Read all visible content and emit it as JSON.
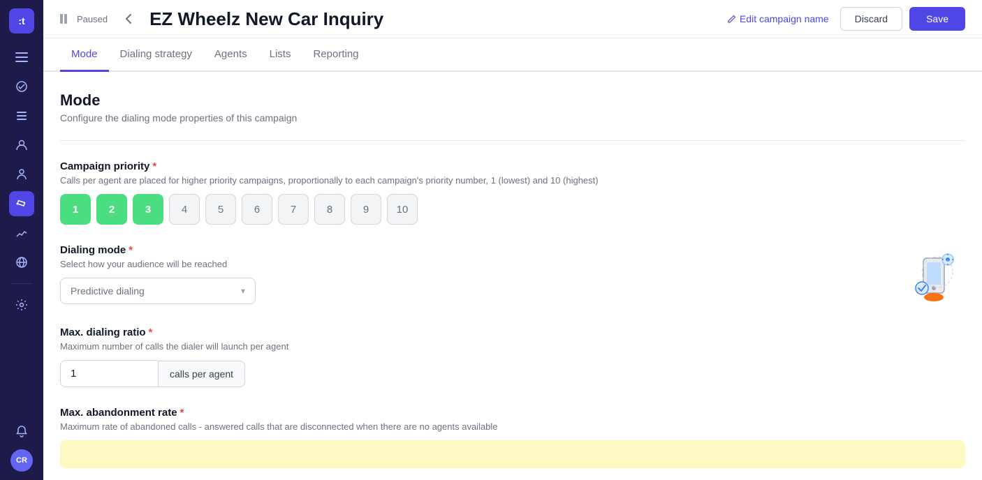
{
  "sidebar": {
    "logo": ":t",
    "items": [
      {
        "name": "menu",
        "icon": "☰",
        "active": false
      },
      {
        "name": "activity",
        "icon": "◎",
        "active": false
      },
      {
        "name": "list",
        "icon": "≡",
        "active": false
      },
      {
        "name": "users",
        "icon": "👤",
        "active": false
      },
      {
        "name": "person",
        "icon": "🧑",
        "active": false
      },
      {
        "name": "campaigns",
        "icon": "📣",
        "active": true
      },
      {
        "name": "analytics",
        "icon": "📊",
        "active": false
      },
      {
        "name": "globe",
        "icon": "🌐",
        "active": false
      },
      {
        "name": "settings",
        "icon": "⚙",
        "active": false
      }
    ],
    "bottom": {
      "bell_icon": "🔔",
      "avatar_label": "CR"
    }
  },
  "header": {
    "status": "Paused",
    "back_label": "‹",
    "campaign_title": "EZ Wheelz New Car Inquiry",
    "edit_link": "Edit campaign name",
    "discard_label": "Discard",
    "save_label": "Save"
  },
  "tabs": [
    {
      "id": "mode",
      "label": "Mode",
      "active": true
    },
    {
      "id": "dialing-strategy",
      "label": "Dialing strategy",
      "active": false
    },
    {
      "id": "agents",
      "label": "Agents",
      "active": false
    },
    {
      "id": "lists",
      "label": "Lists",
      "active": false
    },
    {
      "id": "reporting",
      "label": "Reporting",
      "active": false
    }
  ],
  "mode_section": {
    "title": "Mode",
    "description": "Configure the dialing mode properties of this campaign",
    "campaign_priority": {
      "label": "Campaign priority",
      "hint": "Calls per agent are placed for higher priority campaigns, proportionally to each campaign's priority number, 1 (lowest) and 10 (highest)",
      "options": [
        1,
        2,
        3,
        4,
        5,
        6,
        7,
        8,
        9,
        10
      ],
      "selected": [
        1,
        2,
        3
      ]
    },
    "dialing_mode": {
      "label": "Dialing mode",
      "hint": "Select how your audience will be reached",
      "value": "Predictive dialing",
      "placeholder": "Predictive dialing"
    },
    "max_dialing_ratio": {
      "label": "Max. dialing ratio",
      "hint": "Maximum number of calls the dialer will launch per agent",
      "value": "1",
      "unit": "calls per agent"
    },
    "max_abandonment_rate": {
      "label": "Max. abandonment rate",
      "hint": "Maximum rate of abandoned calls - answered calls that are disconnected when there are no agents available"
    }
  }
}
